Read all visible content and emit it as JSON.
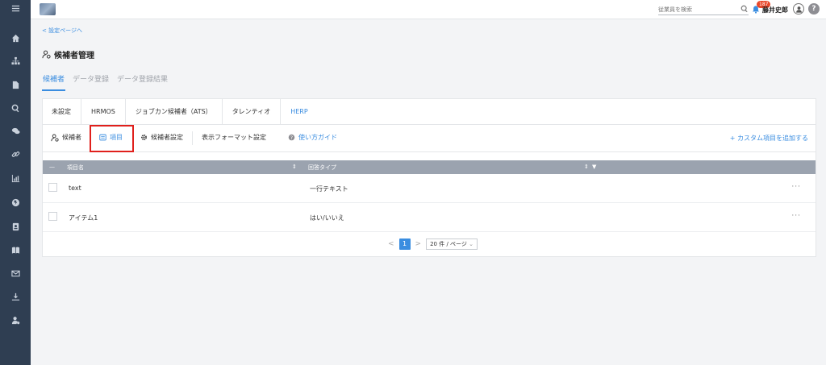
{
  "topbar": {
    "search_placeholder": "従業員を検索",
    "notification_count": "187",
    "user_name": "藤井史郎",
    "help_label": "?"
  },
  "sidebar": {
    "icons": [
      "home-icon",
      "org-chart-icon",
      "document-icon",
      "search-icon",
      "chat-icon",
      "link-icon",
      "chart-icon",
      "globe-icon",
      "contact-card-icon",
      "book-icon",
      "mail-icon",
      "download-icon",
      "user-settings-icon"
    ]
  },
  "breadcrumb": {
    "back_label": "< 設定ページへ"
  },
  "page": {
    "title": "候補者管理"
  },
  "main_tabs": [
    {
      "label": "候補者",
      "active": true
    },
    {
      "label": "データ登録",
      "active": false
    },
    {
      "label": "データ登録結果",
      "active": false
    }
  ],
  "source_tabs": [
    {
      "label": "未設定"
    },
    {
      "label": "HRMOS"
    },
    {
      "label": "ジョブカン候補者（ATS）"
    },
    {
      "label": "タレンティオ"
    },
    {
      "label": "HERP"
    }
  ],
  "sub_bar": {
    "candidates": "候補者",
    "items": "項目",
    "candidate_settings": "候補者設定",
    "display_format": "表示フォーマット設定",
    "guide": "使い方ガイド",
    "add_custom": "+ カスタム項目を追加する"
  },
  "table": {
    "headers": {
      "select": "—",
      "name": "項目名",
      "answer_type": "回答タイプ"
    },
    "rows": [
      {
        "name": "text",
        "answer_type": "一行テキスト",
        "more": "···"
      },
      {
        "name": "アイテム1",
        "answer_type": "はい/いいえ",
        "more": "···"
      }
    ]
  },
  "pagination": {
    "prev": "<",
    "current": "1",
    "next": ">",
    "page_size": "20 件 / ページ"
  },
  "colors": {
    "sidebar": "#2f3e52",
    "accent": "#3a8de0",
    "highlight": "#e0201c",
    "table_header": "#9ba3af"
  }
}
